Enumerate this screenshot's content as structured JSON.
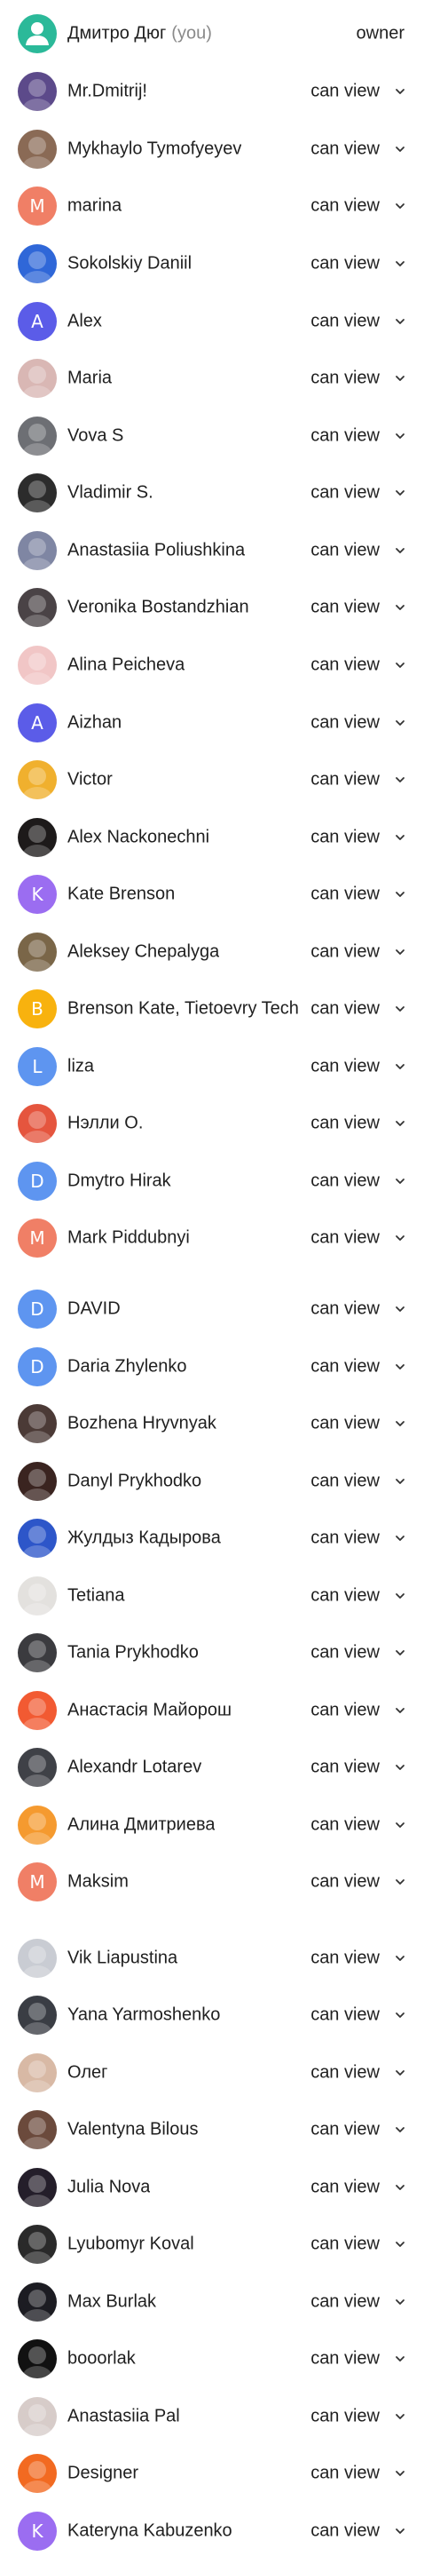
{
  "you_label": "(you)",
  "owner_row": {
    "name": "Дмитро Дюг",
    "role": "owner",
    "avatar": {
      "type": "icon",
      "icon": "person-icon",
      "color": "#2bb999"
    }
  },
  "role_label": "can view",
  "members": [
    {
      "name": "Mr.Dmitrij!",
      "avatar": {
        "type": "photo",
        "color": "#5c4a8a"
      }
    },
    {
      "name": "Mykhaylo Tymofyeyev",
      "avatar": {
        "type": "photo",
        "color": "#8a6a55"
      }
    },
    {
      "name": "marina",
      "avatar": {
        "type": "letter",
        "letter": "M",
        "color": "#f07f66"
      }
    },
    {
      "name": "Sokolskiy Daniil",
      "avatar": {
        "type": "photo",
        "color": "#2f67d8"
      }
    },
    {
      "name": "Alex",
      "avatar": {
        "type": "letter",
        "letter": "A",
        "color": "#5b5ce8"
      }
    },
    {
      "name": "Maria",
      "avatar": {
        "type": "photo",
        "color": "#d9b7b4"
      }
    },
    {
      "name": "Vova S",
      "avatar": {
        "type": "photo",
        "color": "#6d6f74"
      }
    },
    {
      "name": "Vladimir S.",
      "avatar": {
        "type": "photo",
        "color": "#2c2c2c"
      }
    },
    {
      "name": "Anastasiia Poliushkina",
      "avatar": {
        "type": "photo",
        "color": "#7f86a3"
      }
    },
    {
      "name": "Veronika Bostandzhian",
      "avatar": {
        "type": "photo",
        "color": "#4a4346"
      }
    },
    {
      "name": "Alina Peicheva",
      "avatar": {
        "type": "photo",
        "color": "#f1c6c6"
      }
    },
    {
      "name": "Aizhan",
      "avatar": {
        "type": "letter",
        "letter": "A",
        "color": "#5b5ce8"
      }
    },
    {
      "name": "Victor",
      "avatar": {
        "type": "photo",
        "color": "#f0b02e"
      }
    },
    {
      "name": "Alex Nackonechni",
      "avatar": {
        "type": "photo",
        "color": "#1d1a1a"
      }
    },
    {
      "name": "Kate Brenson",
      "avatar": {
        "type": "letter",
        "letter": "K",
        "color": "#9b6df1"
      }
    },
    {
      "name": "Aleksey Chepalyga",
      "avatar": {
        "type": "photo",
        "color": "#7a6648"
      }
    },
    {
      "name": "Brenson Kate, Tietoevry Tech",
      "avatar": {
        "type": "letter",
        "letter": "B",
        "color": "#f8b20e"
      }
    },
    {
      "name": "liza",
      "avatar": {
        "type": "letter",
        "letter": "L",
        "color": "#5e95f0"
      }
    },
    {
      "name": "Нэлли О.",
      "avatar": {
        "type": "photo",
        "color": "#e5553e"
      }
    },
    {
      "name": "Dmytro Hirak",
      "avatar": {
        "type": "letter",
        "letter": "D",
        "color": "#5e95f0"
      }
    },
    {
      "name": "Mark Piddubnyi",
      "avatar": {
        "type": "letter",
        "letter": "M",
        "color": "#f07f66"
      }
    },
    {
      "name": "DAVID",
      "avatar": {
        "type": "letter",
        "letter": "D",
        "color": "#5e95f0"
      }
    },
    {
      "name": "Daria Zhylenko",
      "avatar": {
        "type": "letter",
        "letter": "D",
        "color": "#5e95f0"
      }
    },
    {
      "name": "Bozhena Hryvnyak",
      "avatar": {
        "type": "photo",
        "color": "#4b3a36"
      }
    },
    {
      "name": "Danyl Prykhodko",
      "avatar": {
        "type": "photo",
        "color": "#3a2420"
      }
    },
    {
      "name": "Жулдыз Кадырова",
      "avatar": {
        "type": "photo",
        "color": "#2d56c9"
      }
    },
    {
      "name": "Tetiana",
      "avatar": {
        "type": "photo",
        "color": "#e3e1de"
      }
    },
    {
      "name": "Tania Prykhodko",
      "avatar": {
        "type": "photo",
        "color": "#3b3b3f"
      }
    },
    {
      "name": "Анастасія Майорош",
      "avatar": {
        "type": "photo",
        "color": "#f25a32"
      }
    },
    {
      "name": "Alexandr Lotarev",
      "avatar": {
        "type": "photo",
        "color": "#3f4147"
      }
    },
    {
      "name": "Алина Дмитриева",
      "avatar": {
        "type": "photo",
        "color": "#f59a2f"
      }
    },
    {
      "name": "Maksim",
      "avatar": {
        "type": "letter",
        "letter": "M",
        "color": "#f07f66"
      }
    },
    {
      "name": "Vik Liapustina",
      "avatar": {
        "type": "photo",
        "color": "#c9ccd3"
      }
    },
    {
      "name": "Yana Yarmoshenko",
      "avatar": {
        "type": "photo",
        "color": "#3a3d44"
      }
    },
    {
      "name": "Олег",
      "avatar": {
        "type": "photo",
        "color": "#d8b9a5"
      }
    },
    {
      "name": "Valentyna Bilous",
      "avatar": {
        "type": "photo",
        "color": "#6b4a3c"
      }
    },
    {
      "name": "Julia Nova",
      "avatar": {
        "type": "photo",
        "color": "#241e2a"
      }
    },
    {
      "name": "Lyubomyr Koval",
      "avatar": {
        "type": "photo",
        "color": "#2a2a2a"
      }
    },
    {
      "name": "Max Burlak",
      "avatar": {
        "type": "photo",
        "color": "#1c1c22"
      }
    },
    {
      "name": "booorlak",
      "avatar": {
        "type": "photo",
        "color": "#111111"
      }
    },
    {
      "name": "Anastasiia Pal",
      "avatar": {
        "type": "photo",
        "color": "#d7ccc9"
      }
    },
    {
      "name": "Designer",
      "avatar": {
        "type": "photo",
        "color": "#f26a21"
      }
    },
    {
      "name": "Kateryna Kabuzenko",
      "avatar": {
        "type": "letter",
        "letter": "K",
        "color": "#9b6df1"
      }
    }
  ]
}
